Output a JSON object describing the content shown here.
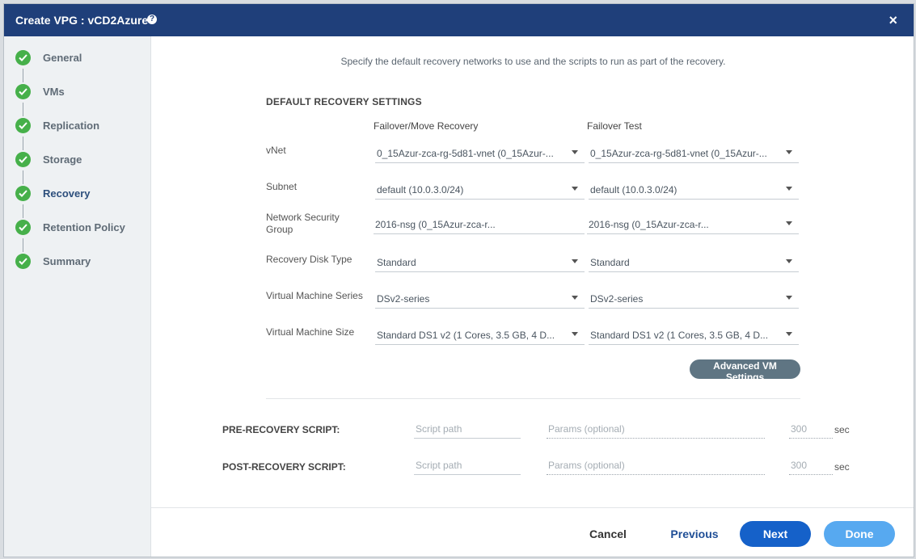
{
  "dialog": {
    "title": "Create VPG : vCD2Azure",
    "help_icon": "?",
    "close_icon": "×"
  },
  "sidebar": {
    "steps": [
      {
        "label": "General",
        "status": "complete"
      },
      {
        "label": "VMs",
        "status": "complete"
      },
      {
        "label": "Replication",
        "status": "complete"
      },
      {
        "label": "Storage",
        "status": "complete"
      },
      {
        "label": "Recovery",
        "status": "complete"
      },
      {
        "label": "Retention Policy",
        "status": "complete"
      },
      {
        "label": "Summary",
        "status": "complete"
      }
    ],
    "check_color": "#46b04a"
  },
  "main": {
    "intro": "Specify the default recovery networks to use and the scripts to run as part of the recovery.",
    "section_title": "DEFAULT RECOVERY SETTINGS",
    "columns": [
      "Failover/Move Recovery",
      "Failover Test"
    ],
    "rows": [
      {
        "label": "vNet",
        "failover": "0_15Azur-zca-rg-5d81-vnet (0_15Azur-...",
        "test": "0_15Azur-zca-rg-5d81-vnet (0_15Azur-..."
      },
      {
        "label": "Subnet",
        "failover": "default (10.0.3.0/24)",
        "test": "default (10.0.3.0/24)"
      },
      {
        "label": "Network Security Group",
        "failover": "2016-nsg (0_15Azur-zca-r...",
        "test": "2016-nsg (0_15Azur-zca-r..."
      },
      {
        "label": "Recovery Disk Type",
        "failover": "Standard",
        "test": "Standard"
      },
      {
        "label": "Virtual Machine Series",
        "failover": "DSv2-series",
        "test": "DSv2-series"
      },
      {
        "label": "Virtual Machine Size",
        "failover": "Standard DS1 v2 (1 Cores, 3.5 GB, 4 D...",
        "test": "Standard DS1 v2 (1 Cores, 3.5 GB, 4 D..."
      }
    ],
    "advanced_button": "Advanced VM Settings",
    "scripts": {
      "pre": {
        "label": "PRE-RECOVERY SCRIPT:",
        "path_placeholder": "Script path",
        "params_placeholder": "Params (optional)",
        "timeout_placeholder": "300",
        "unit": "sec"
      },
      "post": {
        "label": "POST-RECOVERY SCRIPT:",
        "path_placeholder": "Script path",
        "params_placeholder": "Params (optional)",
        "timeout_placeholder": "300",
        "unit": "sec"
      }
    }
  },
  "footer": {
    "cancel": "Cancel",
    "previous": "Previous",
    "next": "Next",
    "done": "Done"
  },
  "colors": {
    "titlebar": "#1f3f7a",
    "primary": "#1561c9",
    "done": "#57a9f0",
    "advanced": "#5f7583"
  }
}
